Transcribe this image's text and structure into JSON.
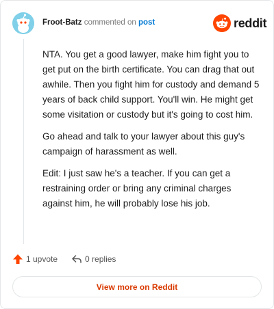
{
  "header": {
    "username": "Froot-Batz",
    "commented_on": "commented on",
    "post_link": "post"
  },
  "brand": {
    "name": "reddit",
    "logo_icon": "reddit-snoo-icon",
    "color": "#ff4500"
  },
  "avatar": {
    "icon": "snoo-avatar-icon",
    "background": "#7fd0e8"
  },
  "comment": {
    "paragraphs": [
      "NTA. You get a good lawyer, make him fight you to get put on the birth certificate. You can drag that out awhile. Then you fight him for custody and demand 5 years of back child support. You'll win. He might get some visitation or custody but it's going to cost him.",
      "Go ahead and talk to your lawyer about this guy's campaign of harassment as well.",
      "Edit: I just saw he's a teacher. If you can get a restraining order or bring any criminal charges against him, he will probably lose his job."
    ]
  },
  "actions": {
    "upvote_label": "1 upvote",
    "upvote_icon": "upvote-arrow-icon",
    "upvote_color": "#ff4500",
    "replies_label": "0 replies",
    "replies_icon": "reply-arrow-icon"
  },
  "footer": {
    "view_more_label": "View more on Reddit",
    "accent": "#d93a00"
  }
}
